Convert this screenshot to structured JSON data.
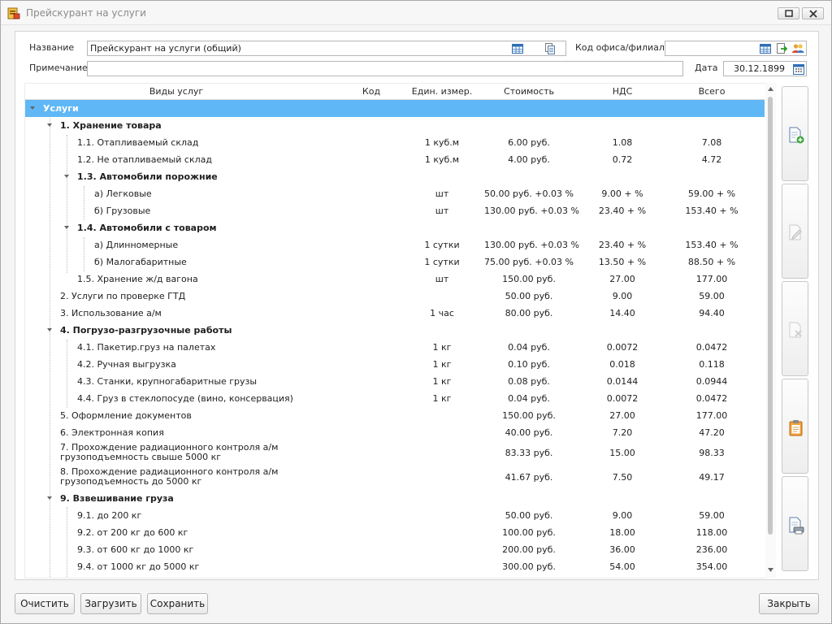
{
  "window": {
    "title": "Прейскурант на услуги"
  },
  "form": {
    "name_label": "Название",
    "name_value": "Прейскурант на услуги (общий)",
    "office_label": "Код офиса/филиала",
    "office_value": "",
    "note_label": "Примечание",
    "note_value": "",
    "date_label": "Дата",
    "date_value": "30.12.1899"
  },
  "grid": {
    "columns": [
      "Виды услуг",
      "Код",
      "Един. измер.",
      "Стоимость",
      "НДС",
      "Всего"
    ],
    "rows": [
      {
        "name": "Услуги",
        "unit": "",
        "cost": "",
        "vat": "",
        "total": ""
      },
      {
        "name": "1. Хранение товара",
        "unit": "",
        "cost": "",
        "vat": "",
        "total": ""
      },
      {
        "name": "1.1. Отапливаемый склад",
        "unit": "1 куб.м",
        "cost": "6.00 руб.",
        "vat": "1.08",
        "total": "7.08"
      },
      {
        "name": "1.2. Не отапливаемый склад",
        "unit": "1 куб.м",
        "cost": "4.00 руб.",
        "vat": "0.72",
        "total": "4.72"
      },
      {
        "name": "1.3. Автомобили порожние",
        "unit": "",
        "cost": "",
        "vat": "",
        "total": ""
      },
      {
        "name": "а) Легковые",
        "unit": "шт",
        "cost": "50.00 руб. +0.03 %",
        "vat": "9.00 + %",
        "total": "59.00 + %"
      },
      {
        "name": "б) Грузовые",
        "unit": "шт",
        "cost": "130.00 руб. +0.03 %",
        "vat": "23.40 + %",
        "total": "153.40 + %"
      },
      {
        "name": "1.4. Автомобили с товаром",
        "unit": "",
        "cost": "",
        "vat": "",
        "total": ""
      },
      {
        "name": "а) Длинномерные",
        "unit": "1 сутки",
        "cost": "130.00 руб. +0.03 %",
        "vat": "23.40 + %",
        "total": "153.40 + %"
      },
      {
        "name": "б) Малогабаритные",
        "unit": "1 сутки",
        "cost": "75.00 руб. +0.03 %",
        "vat": "13.50 + %",
        "total": "88.50 + %"
      },
      {
        "name": "1.5. Хранение ж/д вагона",
        "unit": "шт",
        "cost": "150.00 руб.",
        "vat": "27.00",
        "total": "177.00"
      },
      {
        "name": "2. Услуги по проверке ГТД",
        "unit": "",
        "cost": "50.00 руб.",
        "vat": "9.00",
        "total": "59.00"
      },
      {
        "name": "3. Использование а/м",
        "unit": "1 час",
        "cost": "80.00 руб.",
        "vat": "14.40",
        "total": "94.40"
      },
      {
        "name": "4. Погрузо-разгрузочные работы",
        "unit": "",
        "cost": "",
        "vat": "",
        "total": ""
      },
      {
        "name": "4.1. Пакетир.груз на палетах",
        "unit": "1 кг",
        "cost": "0.04 руб.",
        "vat": "0.0072",
        "total": "0.0472"
      },
      {
        "name": "4.2. Ручная выгрузка",
        "unit": "1 кг",
        "cost": "0.10 руб.",
        "vat": "0.018",
        "total": "0.118"
      },
      {
        "name": "4.3. Станки, крупногабаритные грузы",
        "unit": "1 кг",
        "cost": "0.08 руб.",
        "vat": "0.0144",
        "total": "0.0944"
      },
      {
        "name": "4.4. Груз в стеклопосуде (вино, консервация)",
        "unit": "1 кг",
        "cost": "0.04 руб.",
        "vat": "0.0072",
        "total": "0.0472"
      },
      {
        "name": "5. Оформление документов",
        "unit": "",
        "cost": "150.00 руб.",
        "vat": "27.00",
        "total": "177.00"
      },
      {
        "name": "6. Электронная копия",
        "unit": "",
        "cost": "40.00 руб.",
        "vat": "7.20",
        "total": "47.20"
      },
      {
        "name": "7. Прохождение радиационного контроля а/м грузоподъемность свыше 5000 кг",
        "unit": "",
        "cost": "83.33 руб.",
        "vat": "15.00",
        "total": "98.33"
      },
      {
        "name": "8. Прохождение радиационного контроля а/м грузоподъемность до 5000 кг",
        "unit": "",
        "cost": "41.67 руб.",
        "vat": "7.50",
        "total": "49.17"
      },
      {
        "name": "9. Взвешивание груза",
        "unit": "",
        "cost": "",
        "vat": "",
        "total": ""
      },
      {
        "name": "9.1. до 200 кг",
        "unit": "",
        "cost": "50.00 руб.",
        "vat": "9.00",
        "total": "59.00"
      },
      {
        "name": "9.2. от 200 кг до 600 кг",
        "unit": "",
        "cost": "100.00 руб.",
        "vat": "18.00",
        "total": "118.00"
      },
      {
        "name": "9.3. от 600 кг до 1000 кг",
        "unit": "",
        "cost": "200.00 руб.",
        "vat": "36.00",
        "total": "236.00"
      },
      {
        "name": "9.4. от 1000 кг до 5000 кг",
        "unit": "",
        "cost": "300.00 руб.",
        "vat": "54.00",
        "total": "354.00"
      }
    ]
  },
  "buttons": {
    "clear": "Очистить",
    "load": "Загрузить",
    "save": "Сохранить",
    "close": "Закрыть"
  }
}
